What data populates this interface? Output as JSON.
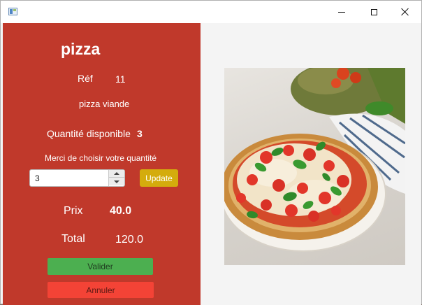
{
  "window": {
    "title": "",
    "icons": {
      "app": "window-app-icon",
      "minimize": "minimize-icon",
      "maximize": "maximize-icon",
      "close": "close-icon"
    }
  },
  "product": {
    "name": "pizza",
    "ref_label": "Réf",
    "ref_value": "11",
    "description": "pizza viande",
    "quantity_label": "Quantité disponible",
    "quantity_value": "3",
    "choose_label": "Merci de choisir votre quantité",
    "selected_quantity": "3",
    "update_label": "Update",
    "price_label": "Prix",
    "price_value": "40.0",
    "total_label": "Total",
    "total_value": "120.0",
    "validate_label": "Valider",
    "cancel_label": "Annuler"
  },
  "image": {
    "subject": "pizza-photo"
  },
  "colors": {
    "panel": "#c0392b",
    "update": "#d4ac0d",
    "validate": "#4caf50",
    "cancel": "#f44336"
  }
}
